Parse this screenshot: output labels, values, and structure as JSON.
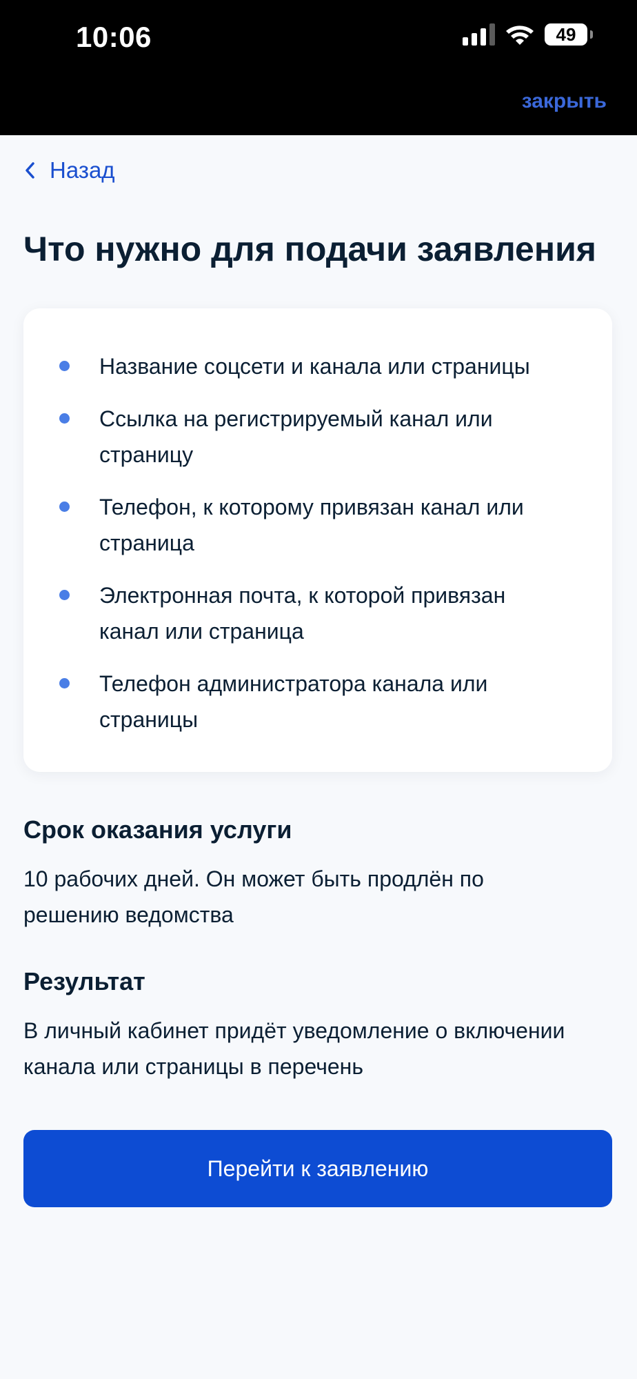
{
  "status_bar": {
    "time": "10:06",
    "battery": "49",
    "icons": [
      "cellular-signal-icon",
      "wifi-icon",
      "battery-icon"
    ]
  },
  "header": {
    "close_label": "закрыть"
  },
  "nav": {
    "back_label": "Назад",
    "back_icon": "chevron-left-icon"
  },
  "page": {
    "title": "Что нужно для подачи заявления"
  },
  "requirements": [
    "Название соцсети и канала или страницы",
    "Ссылка на регистрируемый канал или страницу",
    "Телефон, к которому привязан канал или страница",
    "Электронная почта, к которой привязан канал или страница",
    "Телефон администратора канала или страницы"
  ],
  "term": {
    "title": "Срок оказания услуги",
    "text": "10 рабочих дней. Он может быть продлён по решению ведомства"
  },
  "result": {
    "title": "Результат",
    "text": "В личный кабинет придёт уведомление о включении канала или страницы в перечень"
  },
  "action": {
    "label": "Перейти к заявлению"
  },
  "colors": {
    "primary": "#0d4cd3",
    "link": "#1a4fcf",
    "bullet": "#4a7ee6",
    "text": "#0b1f33",
    "background": "#f7f9fc"
  }
}
